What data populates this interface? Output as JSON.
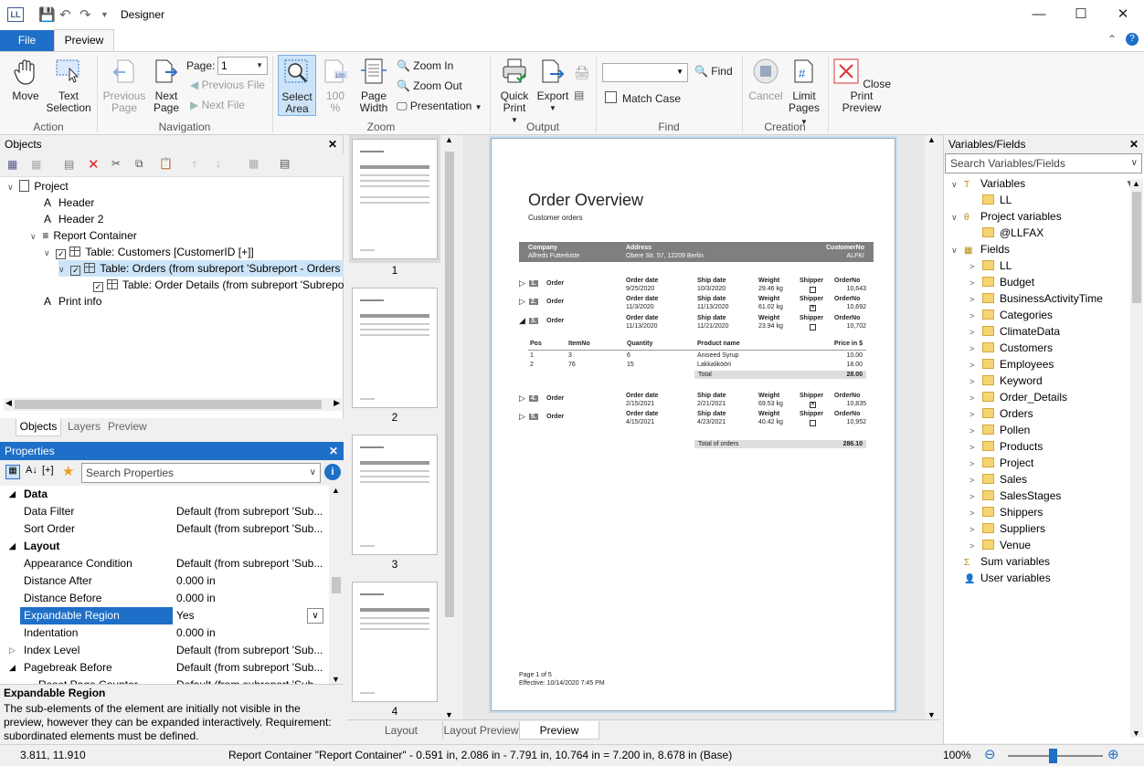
{
  "window": {
    "title": "Designer",
    "app_icon": "LL"
  },
  "tabs": {
    "file": "File",
    "preview": "Preview"
  },
  "ribbon": {
    "move": "Move",
    "text_selection": "Text Selection",
    "previous_page": "Previous Page",
    "next_page": "Next Page",
    "page_label": "Page:",
    "page_value": "1",
    "previous_file": "Previous File",
    "next_file": "Next File",
    "select_area": "Select Area",
    "zoom_100": "100 %",
    "page_width": "Page Width",
    "zoom_in": "Zoom In",
    "zoom_out": "Zoom Out",
    "presentation": "Presentation",
    "quick_print": "Quick Print",
    "export": "Export",
    "find": "Find",
    "match_case": "Match Case",
    "cancel": "Cancel",
    "limit_pages": "Limit Pages",
    "close_print_preview": "Close Print Preview",
    "groups": {
      "action": "Action",
      "navigation": "Navigation",
      "zoom": "Zoom",
      "output": "Output",
      "find": "Find",
      "creation": "Creation"
    }
  },
  "objects": {
    "title": "Objects",
    "tree": [
      {
        "label": "Project"
      },
      {
        "label": "Header"
      },
      {
        "label": "Header 2"
      },
      {
        "label": "Report Container"
      },
      {
        "label": "Table: Customers [CustomerID [+]]"
      },
      {
        "label": "Table: Orders (from subreport 'Subreport - Orders"
      },
      {
        "label": "Table: Order Details (from subreport 'Subrepo"
      },
      {
        "label": "Print info"
      }
    ],
    "tabs": [
      "Objects",
      "Layers",
      "Preview"
    ]
  },
  "properties": {
    "title": "Properties",
    "search_placeholder": "Search Properties",
    "rows": [
      {
        "cat": "Data"
      },
      {
        "name": "Data Filter",
        "value": "Default (from subreport 'Sub..."
      },
      {
        "name": "Sort Order",
        "value": "Default (from subreport 'Sub..."
      },
      {
        "cat": "Layout"
      },
      {
        "name": "Appearance Condition",
        "value": "Default (from subreport 'Sub..."
      },
      {
        "name": "Distance After",
        "value": "0.000 in"
      },
      {
        "name": "Distance Before",
        "value": "0.000 in"
      },
      {
        "name": "Expandable Region",
        "value": "Yes"
      },
      {
        "name": "Indentation",
        "value": "0.000 in"
      },
      {
        "name": "Index Level",
        "value": "Default (from subreport 'Sub..."
      },
      {
        "name": "Pagebreak Before",
        "value": "Default (from subreport 'Sub..."
      },
      {
        "name": "Reset Page Counter",
        "value": "Default (from subreport 'Sub..."
      }
    ],
    "help_title": "Expandable Region",
    "help_text": "The sub-elements of the element are initially not visible in the preview, however they can be expanded interactively. Requirement: subordinated elements must be defined."
  },
  "thumbnails": [
    "1",
    "2",
    "3",
    "4"
  ],
  "report": {
    "title": "Order Overview",
    "subtitle": "Customer orders",
    "hdr_company": "Company",
    "hdr_address": "Address",
    "hdr_customerno": "CustomerNo",
    "company": "Alfreds Futterkiste",
    "address": "Obere Str. 57, 12209 Berlin",
    "customerno": "ALFKI",
    "orders": [
      {
        "n": "1.",
        "date": "9/25/2020",
        "ship": "10/3/2020",
        "weight": "29.46 kg",
        "no": "10,643"
      },
      {
        "n": "2.",
        "date": "11/3/2020",
        "ship": "11/13/2020",
        "weight": "61.02 kg",
        "no": "10,692"
      },
      {
        "n": "3.",
        "date": "11/13/2020",
        "ship": "11/21/2020",
        "weight": "23.94 kg",
        "no": "10,702"
      },
      {
        "n": "4.",
        "date": "2/15/2021",
        "ship": "2/21/2021",
        "weight": "69.53 kg",
        "no": "10,835"
      },
      {
        "n": "5.",
        "date": "4/15/2021",
        "ship": "4/23/2021",
        "weight": "40.42 kg",
        "no": "10,952"
      }
    ],
    "col_order": "Order",
    "col_orderdate": "Order date",
    "col_shipdate": "Ship date",
    "col_weight": "Weight",
    "col_shipper": "Shipper",
    "col_orderno": "OrderNo",
    "details_hdr": [
      "Pos",
      "ItemNo",
      "Quantity",
      "Product name",
      "Price in $"
    ],
    "details": [
      [
        "1",
        "3",
        "6",
        "Aniseed Syrup",
        "10.00"
      ],
      [
        "2",
        "76",
        "15",
        "Lakkalikööri",
        "18.00"
      ]
    ],
    "total_label": "Total",
    "total_value": "28.00",
    "total_orders_label": "Total of orders",
    "total_orders_value": "286.10",
    "footer1": "Page 1 of 5",
    "footer2": "Effective: 10/14/2020 7:45 PM"
  },
  "bottom_tabs": [
    "Layout",
    "Layout Preview",
    "Preview"
  ],
  "varfields": {
    "title": "Variables/Fields",
    "search_placeholder": "Search Variables/Fields",
    "tree": [
      {
        "label": "Variables"
      },
      {
        "label": "LL"
      },
      {
        "label": "Project variables"
      },
      {
        "label": "@LLFAX"
      },
      {
        "label": "Fields"
      },
      {
        "label": "LL"
      },
      {
        "label": "Budget"
      },
      {
        "label": "BusinessActivityTime"
      },
      {
        "label": "Categories"
      },
      {
        "label": "ClimateData"
      },
      {
        "label": "Customers"
      },
      {
        "label": "Employees"
      },
      {
        "label": "Keyword"
      },
      {
        "label": "Order_Details"
      },
      {
        "label": "Orders"
      },
      {
        "label": "Pollen"
      },
      {
        "label": "Products"
      },
      {
        "label": "Project"
      },
      {
        "label": "Sales"
      },
      {
        "label": "SalesStages"
      },
      {
        "label": "Shippers"
      },
      {
        "label": "Suppliers"
      },
      {
        "label": "Venue"
      },
      {
        "label": "Sum variables"
      },
      {
        "label": "User variables"
      }
    ]
  },
  "status": {
    "coords": "3.811, 11.910",
    "info": "Report Container \"Report Container\"  -  0.591 in, 2.086 in  -  7.791 in, 10.764 in  =  7.200 in, 8.678 in (Base)",
    "zoom": "100%"
  },
  "colors": {
    "accent": "#1e6fc8",
    "selection": "#1e6fc8",
    "table_header": "#7f7f7f"
  }
}
